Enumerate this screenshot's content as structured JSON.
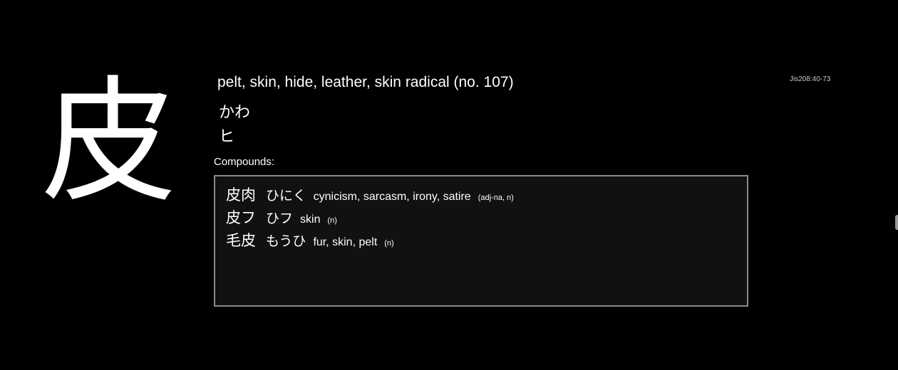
{
  "kanji": "皮",
  "meaning": "pelt, skin, hide, leather, skin radical (no. 107)",
  "kun_reading": "かわ",
  "on_reading": "ヒ",
  "jis_code": "Jis208:40-73",
  "compounds_label": "Compounds:",
  "compounds": [
    {
      "word": "皮肉",
      "reading": "ひにく",
      "gloss": "cynicism, sarcasm, irony, satire",
      "pos": "(adj-na, n)"
    },
    {
      "word": "皮フ",
      "reading": "ひフ",
      "gloss": "skin",
      "pos": "(n)"
    },
    {
      "word": "毛皮",
      "reading": "もうひ",
      "gloss": "fur, skin, pelt",
      "pos": "(n)"
    }
  ]
}
